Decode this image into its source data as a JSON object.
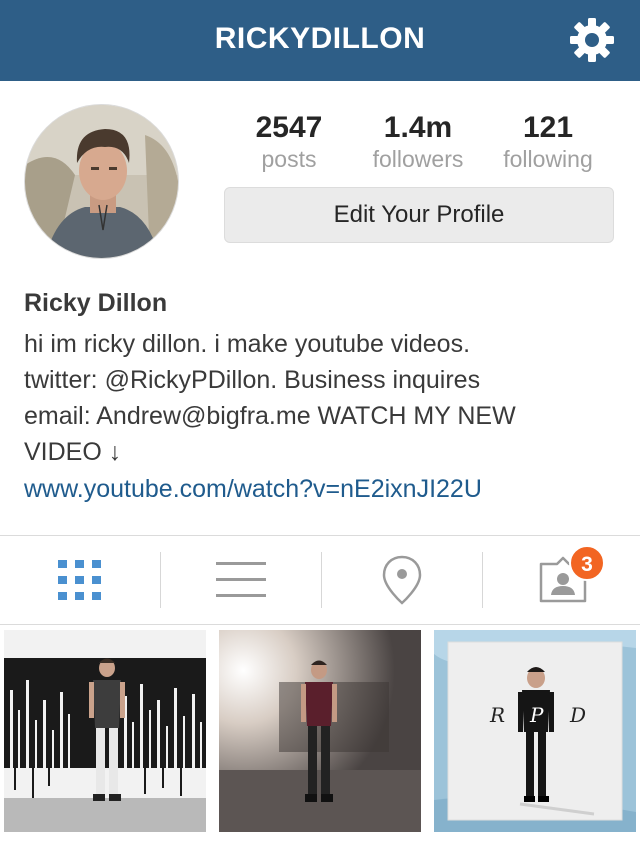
{
  "header": {
    "title": "RICKYDILLON",
    "settings_icon": "gear-icon",
    "color": "#2e5e87"
  },
  "profile": {
    "stats": {
      "posts": {
        "value": "2547",
        "label": "posts"
      },
      "followers": {
        "value": "1.4m",
        "label": "followers"
      },
      "following": {
        "value": "121",
        "label": "following"
      }
    },
    "edit_button_label": "Edit Your Profile",
    "name": "Ricky Dillon",
    "bio": "hi im ricky dillon. i make youtube videos.\ntwitter: @RickyPDillon. Business inquires\nemail: Andrew@bigfra.me WATCH MY NEW\nVIDEO ↓",
    "link": "www.youtube.com/watch?v=nE2ixnJI22U",
    "link_color": "#1f5b8d"
  },
  "tabs": [
    {
      "icon": "grid-icon",
      "active": true
    },
    {
      "icon": "list-icon",
      "active": false
    },
    {
      "icon": "location-pin-icon",
      "active": false
    },
    {
      "icon": "tagged-photos-icon",
      "active": false,
      "badge": "3"
    }
  ],
  "colors": {
    "active_tab": "#4a90d0",
    "inactive_tab": "#9a9a9a",
    "badge": "#f26522"
  },
  "photos": [
    {
      "name": "photo-dripping-paint-wall"
    },
    {
      "name": "photo-studio-light"
    },
    {
      "name": "photo-rpd-album-art",
      "text": [
        "R",
        "P",
        "D"
      ]
    }
  ]
}
